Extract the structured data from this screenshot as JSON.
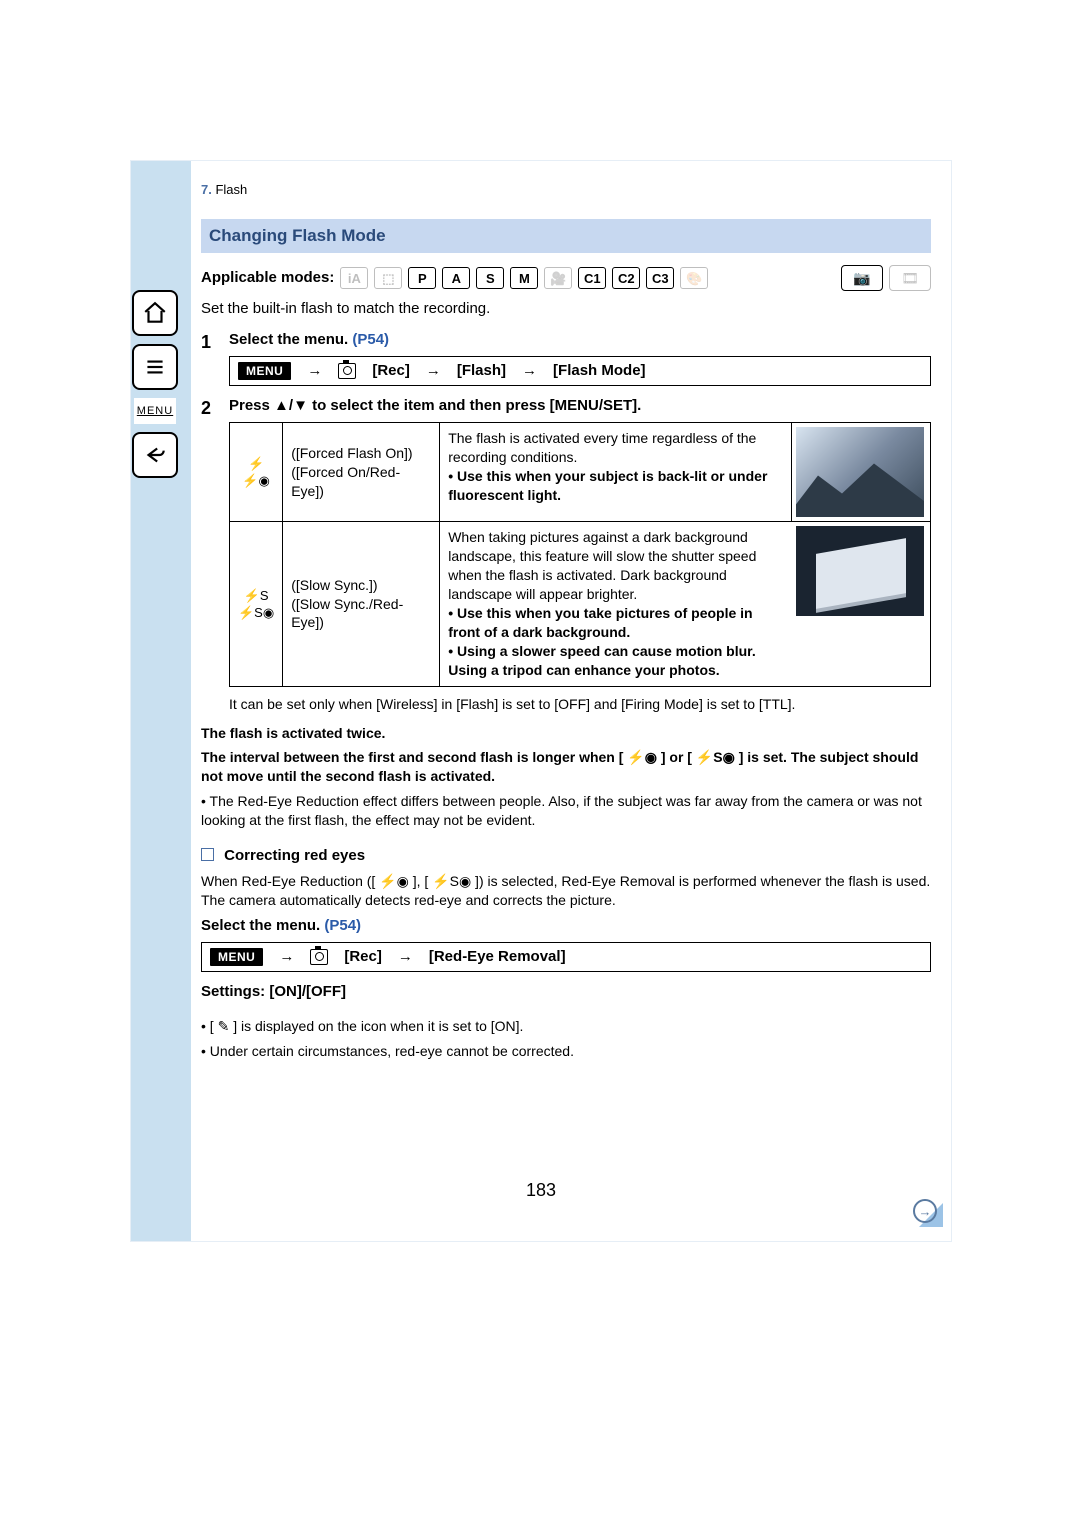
{
  "breadcrumb": {
    "num": "7.",
    "text": "Flash"
  },
  "section_title": "Changing Flash Mode",
  "applicable_label": "Applicable modes:",
  "modes": {
    "p": "P",
    "a": "A",
    "s": "S",
    "m": "M",
    "c1": "C1",
    "c2": "C2",
    "c3": "C3"
  },
  "intro": "Set the built-in flash to match the recording.",
  "step1": {
    "num": "1",
    "title": "Select the menu. ",
    "link": "(P54)"
  },
  "menu_path1": {
    "menu": "MENU",
    "rec": "[Rec]",
    "flash": "[Flash]",
    "mode": "[Flash Mode]",
    "arrow": "→"
  },
  "step2": {
    "num": "2",
    "title_pre": "Press ",
    "title_mid": "/",
    "title_post": " to select the item and then press [MENU/SET]."
  },
  "table": {
    "r1": {
      "sym": "⚡◉",
      "names": "([Forced Flash On])\n([Forced On/Red-Eye])",
      "desc1": "The flash is activated every time regardless of the recording conditions.",
      "desc2_bold": "• Use this when your subject is back-lit or under fluorescent light."
    },
    "r2": {
      "sym1": "⚡S",
      "sym2": "⚡S◉",
      "names": "([Slow Sync.])\n([Slow Sync./Red-Eye])",
      "desc1": "When taking pictures against a dark background landscape, this feature will slow the shutter speed when the flash is activated. Dark background landscape will appear brighter.",
      "desc2_bold": "• Use this when you take pictures of people in front of a dark background.",
      "desc3_bold": "• Using a slower speed can cause motion blur. Using a tripod can enhance your photos."
    }
  },
  "after_table_note": "It can be set only when [Wireless] in [Flash] is set to [OFF] and [Firing Mode] is set to [TTL].",
  "twice_title": "The flash is activated twice.",
  "twice_body": "The interval between the first and second flash is longer when [  ⚡◉  ] or [  ⚡S◉  ] is set. The subject should not move until the second flash is activated.",
  "redeye_note": "• The Red-Eye Reduction effect differs between people. Also, if the subject was far away from the camera or was not looking at the first flash, the effect may not be evident.",
  "correcting_title": "Correcting red eyes",
  "correcting_body": "When Red-Eye Reduction ([ ⚡◉ ], [ ⚡S◉ ]) is selected, Red-Eye Removal is performed whenever the flash is used. The camera automatically detects red-eye and corrects the picture.",
  "step_select2": "Select the menu. ",
  "menu_path2": {
    "menu": "MENU",
    "rec": "[Rec]",
    "item": "[Red-Eye Removal]",
    "arrow": "→"
  },
  "settings_line": "Settings: [ON]/[OFF]",
  "footnote1": "• [ ✎ ] is displayed on the icon when it is set to [ON].",
  "footnote2": "• Under certain circumstances, red-eye cannot be corrected.",
  "page_number": "183",
  "sidebar": {
    "menu_label": "MENU"
  }
}
